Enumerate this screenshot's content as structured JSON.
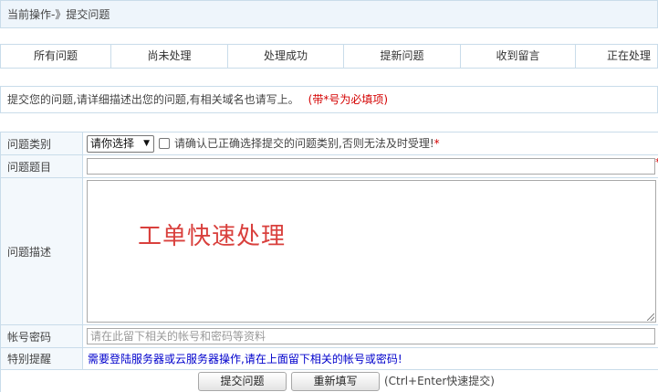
{
  "breadcrumb": "当前操作-》提交问题",
  "tabs": [
    {
      "label": "所有问题"
    },
    {
      "label": "尚未处理"
    },
    {
      "label": "处理成功"
    },
    {
      "label": "提新问题"
    },
    {
      "label": "收到留言"
    },
    {
      "label": "正在处理"
    }
  ],
  "notice": {
    "text": "提交您的问题,请详细描述出您的问题,有相关域名也请写上。",
    "required_note": "(带*号为必填项)"
  },
  "form": {
    "category": {
      "label": "问题类别",
      "selected": "请你选择",
      "checkbox_text": "请确认已正确选择提交的问题类别,否则无法及时受理!",
      "star": "*"
    },
    "title": {
      "label": "问题题目",
      "value": "",
      "star": "*"
    },
    "description": {
      "label": "问题描述",
      "content": "工单快速处理"
    },
    "account": {
      "label": "帐号密码",
      "placeholder": "请在此留下相关的帐号和密码等资料"
    },
    "reminder": {
      "label": "特别提醒",
      "text": "需要登陆服务器或云服务器操作,请在上面留下相关的帐号或密码!"
    }
  },
  "buttons": {
    "submit": "提交问题",
    "reset": "重新填写",
    "hint": "(Ctrl+Enter快速提交)"
  },
  "colors": {
    "border": "#c9dcea",
    "label_bg": "#f3f8fc",
    "required": "#d40000",
    "reminder": "#0000cc"
  }
}
